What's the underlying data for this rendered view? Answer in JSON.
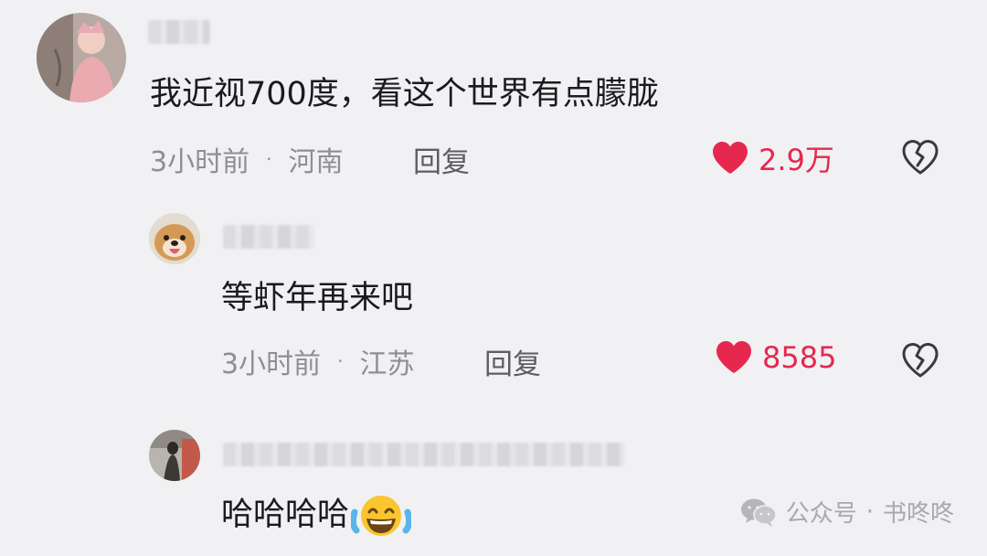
{
  "comments": [
    {
      "text": "我近视700度，看这个世界有点朦胧",
      "time": "3小时前",
      "location": "河南",
      "reply_label": "回复",
      "likes": "2.9万"
    },
    {
      "text": "等虾年再来吧",
      "time": "3小时前",
      "location": "江苏",
      "reply_label": "回复",
      "likes": "8585"
    },
    {
      "text": "哈哈哈哈"
    }
  ],
  "separator": "·",
  "watermark": {
    "label": "公众号",
    "separator": "·",
    "author": "书咚咚"
  },
  "colors": {
    "like": "#e6284f",
    "meta": "#8e8e93",
    "background": "#f1f1f3"
  },
  "icons": {
    "like": "heart-icon",
    "dislike": "broken-heart-icon",
    "emoji": "tears-of-joy-emoji-icon",
    "watermark": "wechat-icon"
  }
}
